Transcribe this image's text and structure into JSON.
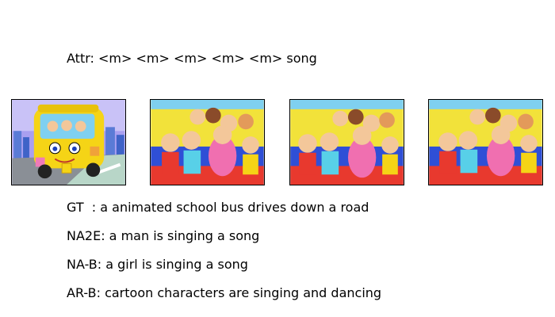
{
  "attr_line": "Attr: <m> <m> <m> <m> <m> song",
  "frames": [
    {
      "name": "frame-school-bus",
      "description_icon": "cartoon-school-bus-icon"
    },
    {
      "name": "frame-cartoon-kids-bus-interior-1",
      "description_icon": "cartoon-children-icon"
    },
    {
      "name": "frame-cartoon-kids-bus-interior-2",
      "description_icon": "cartoon-children-icon"
    },
    {
      "name": "frame-cartoon-kids-bus-interior-3",
      "description_icon": "cartoon-children-icon"
    }
  ],
  "captions": {
    "gt": "GT  : a animated school bus drives down a road",
    "na2e": "NA2E: a man is singing a song",
    "nab": "NA-B: a girl is singing a song",
    "arb": "AR-B: cartoon characters are singing and dancing"
  },
  "colors": {
    "bus_yellow": "#f5d416",
    "sky_purple": "#9b8fe6",
    "road_gray": "#8a8f96",
    "seat_blue": "#2f4fd6",
    "wall_yellow": "#f2e23a",
    "pink_dress": "#f06fb0"
  }
}
